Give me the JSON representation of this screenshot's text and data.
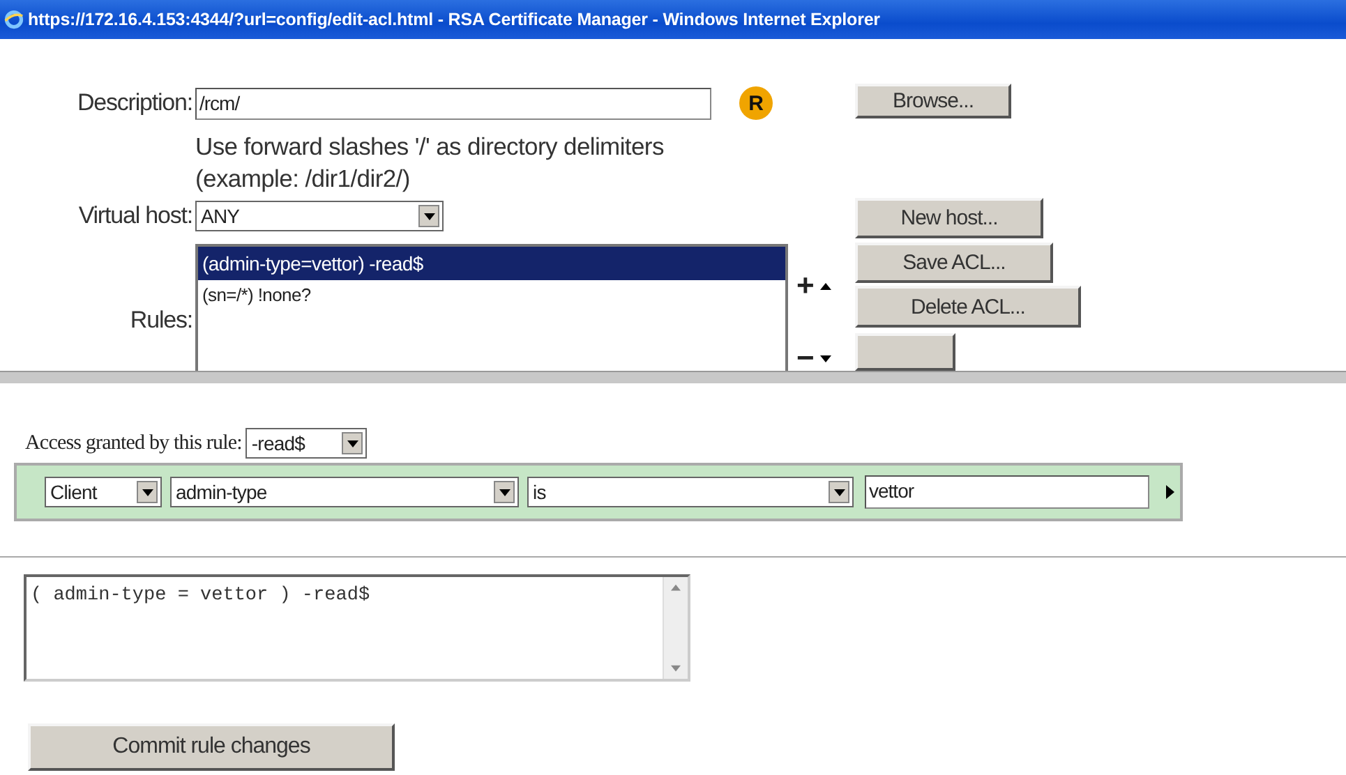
{
  "window": {
    "title": "https://172.16.4.153:4344/?url=config/edit-acl.html - RSA Certificate Manager - Windows Internet Explorer"
  },
  "description": {
    "label": "Description:",
    "value": "/rcm/",
    "badge": "R",
    "hint_lines": [
      "Use forward slashes '/' as directory delimiters",
      "(example: /dir1/dir2/)"
    ]
  },
  "browse_button": "Browse...",
  "virtual_host": {
    "label": "Virtual host:",
    "value": "ANY"
  },
  "new_host_button": "New host...",
  "rules": {
    "label": "Rules:",
    "add": "+",
    "remove": "−",
    "items": [
      {
        "text": "(admin-type=vettor) -read$",
        "selected": true
      },
      {
        "text": "(sn=/*) !none?",
        "selected": false
      }
    ]
  },
  "acl_buttons": [
    "Save ACL...",
    "Delete ACL..."
  ],
  "access": {
    "label": "Access granted by this rule:",
    "value": "-read$"
  },
  "condition": {
    "scope": "Client",
    "attribute": "admin-type",
    "operator": "is",
    "value": "vettor"
  },
  "expression": "( admin-type = vettor ) -read$",
  "commit_button": "Commit rule changes"
}
